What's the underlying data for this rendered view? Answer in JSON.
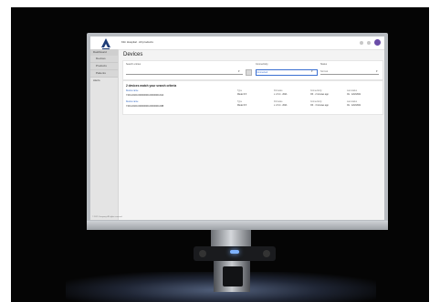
{
  "app": {
    "org_name": "Kiln Hospital · All products",
    "logo_text": "CLINIC"
  },
  "sidebar": {
    "items": [
      {
        "label": "Dashboard"
      },
      {
        "label": "Devices"
      },
      {
        "label": "Products"
      },
      {
        "label": "Patients"
      },
      {
        "label": "Alerts"
      }
    ],
    "footer": "© 2021 Company. All rights reserved."
  },
  "page": {
    "title": "Devices"
  },
  "filters": {
    "search_label": "Search entries",
    "search_placeholder": "",
    "connectivity_label": "Connectivity",
    "connectivity_value": "Connected",
    "status_label": "Status",
    "status_value": "Normal"
  },
  "results": {
    "title": "2 devices match your search criteria",
    "headers": {
      "device": "Device name",
      "type": "Type",
      "firmware": "Firmware",
      "connectivity": "Connectivity",
      "status": "Last status"
    },
    "rows": [
      {
        "device": "Device name",
        "id": "7401-0020-00000000-0000000-00A",
        "type": "Infusion",
        "type_sub": "Model 3.5",
        "firmware": "Firmware",
        "firmware_sub": "v. 2.3.4 · 2021",
        "connectivity": "Connectivity",
        "connectivity_sub": "OK · 2 minutes ago",
        "status": "Last status",
        "status_sub": "Ok · 12/2/2021"
      },
      {
        "device": "Device name",
        "id": "7401-0020-00000000-0000000-00B",
        "type": "Infusion",
        "type_sub": "Model 3.5",
        "firmware": "Firmware",
        "firmware_sub": "v. 2.3.4 · 2021",
        "connectivity": "Connectivity",
        "connectivity_sub": "OK · 3 minutes ago",
        "status": "Last status",
        "status_sub": "Ok · 12/2/2021"
      }
    ]
  }
}
